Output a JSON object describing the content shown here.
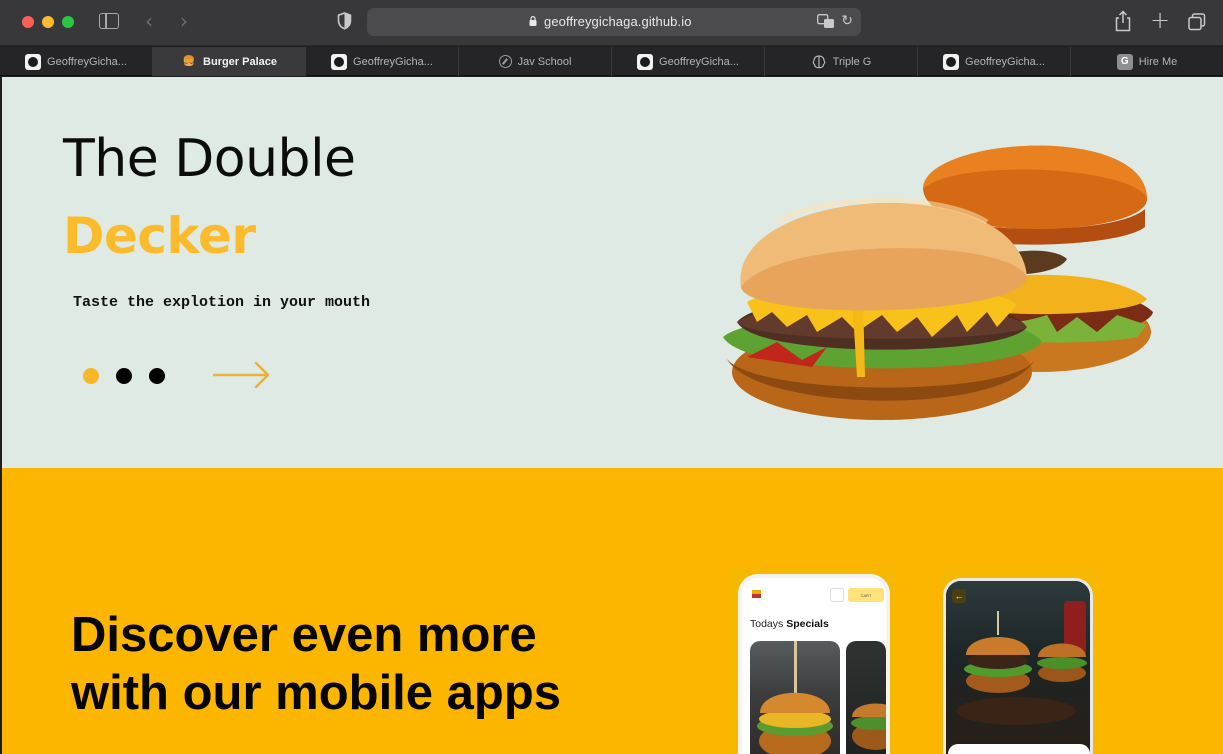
{
  "browser": {
    "url": "geoffreygichaga.github.io",
    "tabs": [
      {
        "label": "GeoffreyGicha...",
        "favicon": "github-icon",
        "active": false
      },
      {
        "label": "Burger Palace",
        "favicon": "burger-icon",
        "active": true
      },
      {
        "label": "GeoffreyGicha...",
        "favicon": "github-icon",
        "active": false
      },
      {
        "label": "Jav School",
        "favicon": "compass-icon",
        "active": false
      },
      {
        "label": "GeoffreyGicha...",
        "favicon": "github-icon",
        "active": false
      },
      {
        "label": "Triple G",
        "favicon": "brain-icon",
        "active": false
      },
      {
        "label": "GeoffreyGicha...",
        "favicon": "github-icon",
        "active": false
      },
      {
        "label": "Hire Me",
        "favicon": "letter-g-icon",
        "active": false
      }
    ],
    "tab_favicon_letter": "G",
    "burger_favicon_glyph": "🍔"
  },
  "hero": {
    "title": "The Double",
    "accent_title": "Decker",
    "tagline": "Taste the explotion in your mouth",
    "slides_total": 3,
    "active_slide": 1,
    "accent_color": "#fbbb2a"
  },
  "promo": {
    "title": "Discover even more with our mobile apps",
    "background_color": "#fdb600",
    "phone1": {
      "heading_prefix": "Todays",
      "heading_bold": "Specials",
      "cart_label": "CART"
    },
    "phone2": {
      "back_glyph": "←"
    }
  }
}
